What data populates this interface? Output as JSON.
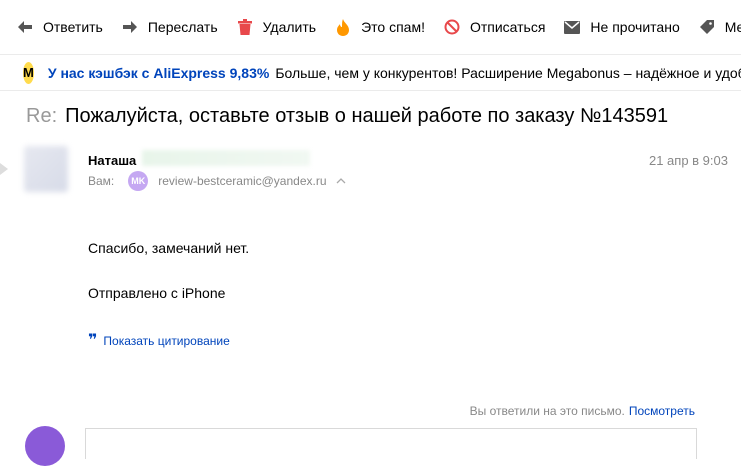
{
  "toolbar": {
    "reply": {
      "label": "Ответить",
      "icon": "reply-arrow-icon"
    },
    "forward": {
      "label": "Переслать",
      "icon": "forward-arrow-icon"
    },
    "delete": {
      "label": "Удалить",
      "icon": "trash-icon",
      "color": "#e8484b"
    },
    "spam": {
      "label": "Это спам!",
      "icon": "fire-icon",
      "color": "#ff9800"
    },
    "unsubscribe": {
      "label": "Отписаться",
      "icon": "no-entry-icon",
      "color": "#e8484b"
    },
    "unread": {
      "label": "Не прочитано",
      "icon": "envelope-icon"
    },
    "label": {
      "label": "Метка",
      "icon": "tag-icon"
    }
  },
  "promo": {
    "logo": "M",
    "title": "У нас кэшбэк с AliExpress 9,83%",
    "text": "Больше, чем у конкурентов! Расширение Megabonus – надёжное и удобное"
  },
  "message": {
    "subject_prefix": "Re:",
    "subject": "Пожалуйста, оставьте отзыв о нашей работе по заказу №143591",
    "sender_name": "Наташа",
    "date": "21 апр в 9:03",
    "to_label": "Вам:",
    "recipient_badge": "MK",
    "recipient_email": "review-bestceramic@yandex.ru",
    "body_line1": "Спасибо, замечаний нет.",
    "body_line2": "Отправлено с iPhone",
    "show_quote": "Показать цитирование"
  },
  "footer": {
    "replied_text": "Вы ответили на это письмо.",
    "view_link": "Посмотреть"
  },
  "colors": {
    "link": "#0044bb",
    "accent_yellow": "#ffdb4d",
    "badge_purple": "#c5a8f2"
  }
}
